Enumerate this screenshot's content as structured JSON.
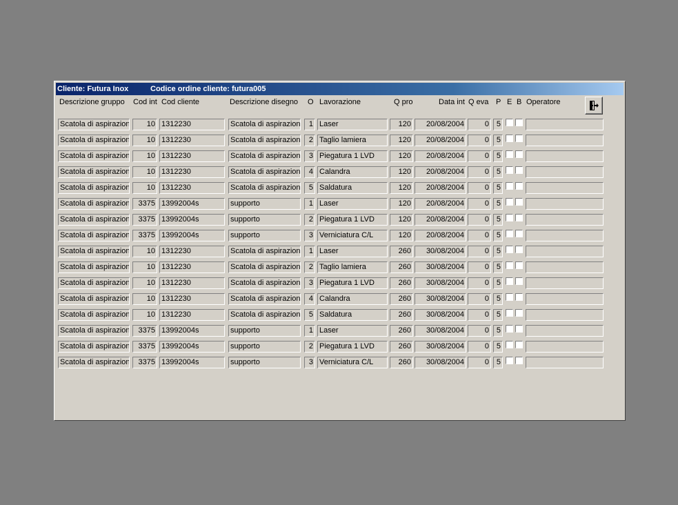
{
  "titlebar": {
    "cliente": "Cliente: Futura Inox",
    "codice_ordine": "Codice ordine cliente: futura005"
  },
  "headers": {
    "descrizione_gruppo": "Descrizione gruppo",
    "cod_int": "Cod int",
    "cod_cliente": "Cod cliente",
    "descrizione_disegno": "Descrizione disegno",
    "o": "O",
    "lavorazione": "Lavorazione",
    "q_pro": "Q pro",
    "data_int": "Data int",
    "q_eva": "Q eva",
    "p": "P",
    "e": "E",
    "b": "B",
    "operatore": "Operatore"
  },
  "icons": {
    "exit": "exit-door-icon"
  },
  "rows": [
    {
      "gruppo": "Scatola di aspirazione",
      "cod_int": "10",
      "cod_cliente": "1312230",
      "disegno": "Scatola di aspirazione",
      "o": "1",
      "lavorazione": "Laser",
      "q_pro": "120",
      "data_int": "20/08/2004",
      "q_eva": "0",
      "p": "5",
      "e": false,
      "b": false,
      "operatore": ""
    },
    {
      "gruppo": "Scatola di aspirazione",
      "cod_int": "10",
      "cod_cliente": "1312230",
      "disegno": "Scatola di aspirazione",
      "o": "2",
      "lavorazione": "Taglio lamiera",
      "q_pro": "120",
      "data_int": "20/08/2004",
      "q_eva": "0",
      "p": "5",
      "e": false,
      "b": false,
      "operatore": ""
    },
    {
      "gruppo": "Scatola di aspirazione",
      "cod_int": "10",
      "cod_cliente": "1312230",
      "disegno": "Scatola di aspirazione",
      "o": "3",
      "lavorazione": "Piegatura 1 LVD",
      "q_pro": "120",
      "data_int": "20/08/2004",
      "q_eva": "0",
      "p": "5",
      "e": false,
      "b": false,
      "operatore": ""
    },
    {
      "gruppo": "Scatola di aspirazione",
      "cod_int": "10",
      "cod_cliente": "1312230",
      "disegno": "Scatola di aspirazione",
      "o": "4",
      "lavorazione": "Calandra",
      "q_pro": "120",
      "data_int": "20/08/2004",
      "q_eva": "0",
      "p": "5",
      "e": false,
      "b": false,
      "operatore": ""
    },
    {
      "gruppo": "Scatola di aspirazione",
      "cod_int": "10",
      "cod_cliente": "1312230",
      "disegno": "Scatola di aspirazione",
      "o": "5",
      "lavorazione": "Saldatura",
      "q_pro": "120",
      "data_int": "20/08/2004",
      "q_eva": "0",
      "p": "5",
      "e": false,
      "b": false,
      "operatore": ""
    },
    {
      "gruppo": "Scatola di aspirazione",
      "cod_int": "3375",
      "cod_cliente": "13992004s",
      "disegno": "supporto",
      "o": "1",
      "lavorazione": "Laser",
      "q_pro": "120",
      "data_int": "20/08/2004",
      "q_eva": "0",
      "p": "5",
      "e": false,
      "b": false,
      "operatore": ""
    },
    {
      "gruppo": "Scatola di aspirazione",
      "cod_int": "3375",
      "cod_cliente": "13992004s",
      "disegno": "supporto",
      "o": "2",
      "lavorazione": "Piegatura 1 LVD",
      "q_pro": "120",
      "data_int": "20/08/2004",
      "q_eva": "0",
      "p": "5",
      "e": false,
      "b": false,
      "operatore": ""
    },
    {
      "gruppo": "Scatola di aspirazione",
      "cod_int": "3375",
      "cod_cliente": "13992004s",
      "disegno": "supporto",
      "o": "3",
      "lavorazione": "Verniciatura C/L",
      "q_pro": "120",
      "data_int": "20/08/2004",
      "q_eva": "0",
      "p": "5",
      "e": false,
      "b": false,
      "operatore": ""
    },
    {
      "gruppo": "Scatola di aspirazione",
      "cod_int": "10",
      "cod_cliente": "1312230",
      "disegno": "Scatola di aspirazione",
      "o": "1",
      "lavorazione": "Laser",
      "q_pro": "260",
      "data_int": "30/08/2004",
      "q_eva": "0",
      "p": "5",
      "e": false,
      "b": false,
      "operatore": ""
    },
    {
      "gruppo": "Scatola di aspirazione",
      "cod_int": "10",
      "cod_cliente": "1312230",
      "disegno": "Scatola di aspirazione",
      "o": "2",
      "lavorazione": "Taglio lamiera",
      "q_pro": "260",
      "data_int": "30/08/2004",
      "q_eva": "0",
      "p": "5",
      "e": false,
      "b": false,
      "operatore": ""
    },
    {
      "gruppo": "Scatola di aspirazione",
      "cod_int": "10",
      "cod_cliente": "1312230",
      "disegno": "Scatola di aspirazione",
      "o": "3",
      "lavorazione": "Piegatura 1 LVD",
      "q_pro": "260",
      "data_int": "30/08/2004",
      "q_eva": "0",
      "p": "5",
      "e": false,
      "b": false,
      "operatore": ""
    },
    {
      "gruppo": "Scatola di aspirazione",
      "cod_int": "10",
      "cod_cliente": "1312230",
      "disegno": "Scatola di aspirazione",
      "o": "4",
      "lavorazione": "Calandra",
      "q_pro": "260",
      "data_int": "30/08/2004",
      "q_eva": "0",
      "p": "5",
      "e": false,
      "b": false,
      "operatore": ""
    },
    {
      "gruppo": "Scatola di aspirazione",
      "cod_int": "10",
      "cod_cliente": "1312230",
      "disegno": "Scatola di aspirazione",
      "o": "5",
      "lavorazione": "Saldatura",
      "q_pro": "260",
      "data_int": "30/08/2004",
      "q_eva": "0",
      "p": "5",
      "e": false,
      "b": false,
      "operatore": ""
    },
    {
      "gruppo": "Scatola di aspirazione",
      "cod_int": "3375",
      "cod_cliente": "13992004s",
      "disegno": "supporto",
      "o": "1",
      "lavorazione": "Laser",
      "q_pro": "260",
      "data_int": "30/08/2004",
      "q_eva": "0",
      "p": "5",
      "e": false,
      "b": false,
      "operatore": ""
    },
    {
      "gruppo": "Scatola di aspirazione",
      "cod_int": "3375",
      "cod_cliente": "13992004s",
      "disegno": "supporto",
      "o": "2",
      "lavorazione": "Piegatura 1 LVD",
      "q_pro": "260",
      "data_int": "30/08/2004",
      "q_eva": "0",
      "p": "5",
      "e": false,
      "b": false,
      "operatore": ""
    },
    {
      "gruppo": "Scatola di aspirazione",
      "cod_int": "3375",
      "cod_cliente": "13992004s",
      "disegno": "supporto",
      "o": "3",
      "lavorazione": "Verniciatura C/L",
      "q_pro": "260",
      "data_int": "30/08/2004",
      "q_eva": "0",
      "p": "5",
      "e": false,
      "b": false,
      "operatore": ""
    }
  ]
}
